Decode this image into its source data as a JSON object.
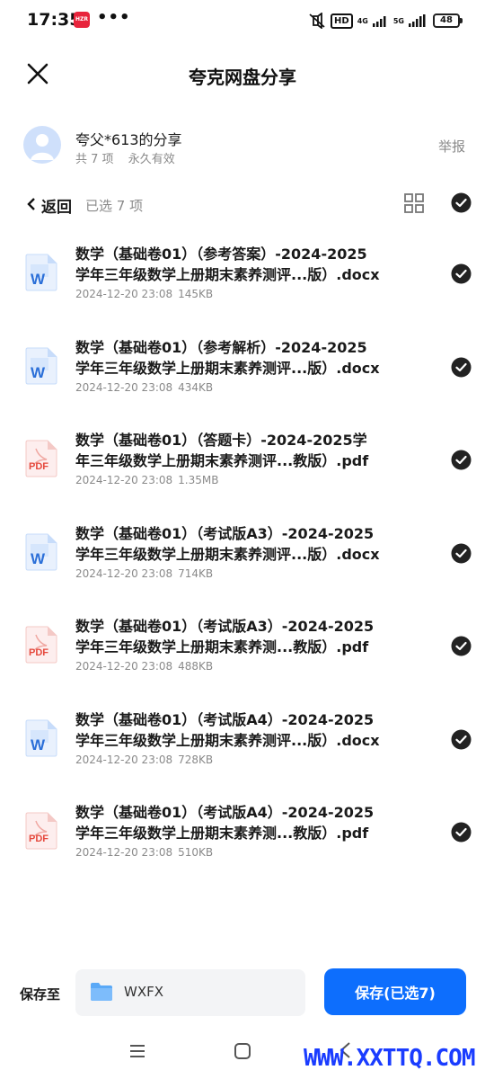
{
  "status_bar": {
    "time": "17:35",
    "app_badge": "HZR",
    "more": "•••",
    "hd": "HD",
    "net1": "4G",
    "net2": "5G",
    "battery": "48"
  },
  "header": {
    "title": "夸克网盘分享"
  },
  "share": {
    "name": "夸父*613的分享",
    "count": "共 7 项",
    "validity": "永久有效",
    "report": "举报"
  },
  "toolbar": {
    "back": "返回",
    "selected": "已选 7 项"
  },
  "files": [
    {
      "type": "docx",
      "name": "数学（基础卷01）（参考答案）-2024-2025\n学年三年级数学上册期末素养测评...版）.docx",
      "date": "2024-12-20 23:08",
      "size": "145KB",
      "badge": "W"
    },
    {
      "type": "docx",
      "name": "数学（基础卷01）（参考解析）-2024-2025\n学年三年级数学上册期末素养测评...版）.docx",
      "date": "2024-12-20 23:08",
      "size": "434KB",
      "badge": "W"
    },
    {
      "type": "pdf",
      "name": "数学（基础卷01）（答题卡）-2024-2025学\n年三年级数学上册期末素养测评...教版）.pdf",
      "date": "2024-12-20 23:08",
      "size": "1.35MB",
      "badge": "PDF"
    },
    {
      "type": "docx",
      "name": "数学（基础卷01）（考试版A3）-2024-2025\n学年三年级数学上册期末素养测评...版）.docx",
      "date": "2024-12-20 23:08",
      "size": "714KB",
      "badge": "W"
    },
    {
      "type": "pdf",
      "name": "数学（基础卷01）（考试版A3）-2024-2025\n学年三年级数学上册期末素养测...教版）.pdf",
      "date": "2024-12-20 23:08",
      "size": "488KB",
      "badge": "PDF"
    },
    {
      "type": "docx",
      "name": "数学（基础卷01）（考试版A4）-2024-2025\n学年三年级数学上册期末素养测评...版）.docx",
      "date": "2024-12-20 23:08",
      "size": "728KB",
      "badge": "W"
    },
    {
      "type": "pdf",
      "name": "数学（基础卷01）（考试版A4）-2024-2025\n学年三年级数学上册期末素养测...教版）.pdf",
      "date": "2024-12-20 23:08",
      "size": "510KB",
      "badge": "PDF"
    }
  ],
  "bottom": {
    "save_to": "保存至",
    "folder": "WXFX",
    "save_button": "保存(已选7)"
  },
  "watermark": "WWW.XXTTQ.COM",
  "colors": {
    "accent": "#0d6efd",
    "word": "#2b6fd8",
    "pdf": "#e5483c",
    "check": "#222222",
    "muted": "#8a8a8a"
  }
}
